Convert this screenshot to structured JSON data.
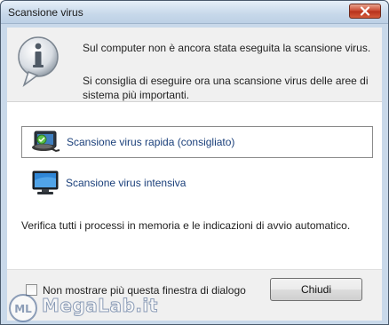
{
  "window": {
    "title": "Scansione virus"
  },
  "header": {
    "line1": "Sul computer non è ancora stata eseguita la scansione virus.",
    "line2": "Si consiglia di eseguire ora una scansione virus delle aree di sistema più importanti.",
    "icon": "info-bubble-icon"
  },
  "options": {
    "quick": {
      "label": "Scansione virus rapida (consigliato)",
      "icon": "quick-scan-icon"
    },
    "full": {
      "label": "Scansione virus intensiva",
      "icon": "monitor-icon"
    }
  },
  "description": "Verifica tutti i processi in memoria e le indicazioni di avvio automatico.",
  "footer": {
    "checkbox_label": "Non mostrare più questa finestra di dialogo",
    "checkbox_checked": false,
    "close_label": "Chiudi"
  },
  "watermark": {
    "text": "MegaLab.it"
  },
  "colors": {
    "link": "#1a3f7a",
    "close_red": "#c9452c"
  }
}
